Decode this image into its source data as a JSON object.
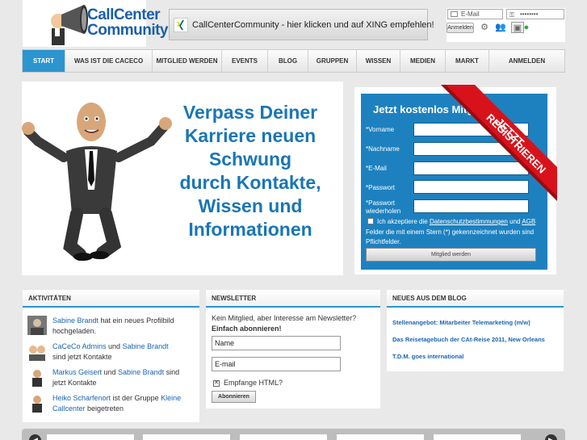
{
  "header": {
    "logo_line1": "CallCenter",
    "logo_line2": "Community",
    "xing_text": "CallCenterCommunity - hier klicken und auf XING empfehlen!",
    "email_placeholder": "E-Mail",
    "password_value": "••••••••",
    "login_label": "Anmelden"
  },
  "nav": {
    "items": [
      "START",
      "WAS IST DIE CACECO",
      "MITGLIED WERDEN",
      "EVENTS",
      "BLOG",
      "GRUPPEN",
      "WISSEN",
      "MEDIEN",
      "MARKT",
      "ANMELDEN"
    ],
    "active": "START"
  },
  "hero": {
    "headline": [
      "Verpass Deiner",
      "Karriere neuen",
      "Schwung",
      "durch Kontakte,",
      "Wissen und",
      "Informationen"
    ]
  },
  "register": {
    "title": "Jetzt kostenlos Mitglied",
    "ribbon_line1": "JETZT",
    "ribbon_line2": "REGISTRIEREN",
    "fields": [
      "*Vorname",
      "*Nachname",
      "*E-Mail",
      "*Passwort",
      "*Passwort wiederholen"
    ],
    "agree_prefix": "Ich akzeptiere die",
    "agree_link1": "Datenschutzbestimmungen",
    "agree_and": "und",
    "agree_link2": "AGB",
    "note": "Felder die mit einem Stern (*) gekennzeichnet wurden sind Pflichtfelder.",
    "submit": "Mitglied werden"
  },
  "activities": {
    "title": "AKTIVITÄTEN",
    "items": [
      {
        "p1": "Sabine Brandt",
        "t1": " hat ein neues Profilbild hochgeladen.",
        "p2": "",
        "t2": ""
      },
      {
        "p1": "CaCeCo Admins",
        "t1": " und ",
        "p2": "Sabine Brandt",
        "t2": " sind jetzt Kontakte"
      },
      {
        "p1": "Markus Geisert",
        "t1": " und ",
        "p2": "Sabine Brandt",
        "t2": " sind jetzt Kontakte"
      },
      {
        "p1": "Heiko Scharfenort",
        "t1": " ist der Gruppe ",
        "p2": "Kleine Callcenter",
        "t2": " beigetreten"
      }
    ]
  },
  "newsletter": {
    "title": "NEWSLETTER",
    "intro": "Kein Mitglied, aber Interesse am Newsletter?",
    "cta": "Einfach abonnieren!",
    "name_value": "Name",
    "email_value": "E-mail",
    "html_label": "Empfange HTML?",
    "submit": "Abonnieren"
  },
  "blog": {
    "title": "NEUES AUS DEM BLOG",
    "links": [
      "Stellenangebot: Mitarbeiter Telemarketing (m/w)",
      "Das Reisetagebuch der CAt-Reise 2011, New Orleans",
      "T.D.M. goes international"
    ]
  },
  "colors": {
    "accent": "#2b95cf",
    "register_bg": "#1e81bf",
    "ribbon_red": "#d8121b",
    "link": "#1a64b0"
  }
}
